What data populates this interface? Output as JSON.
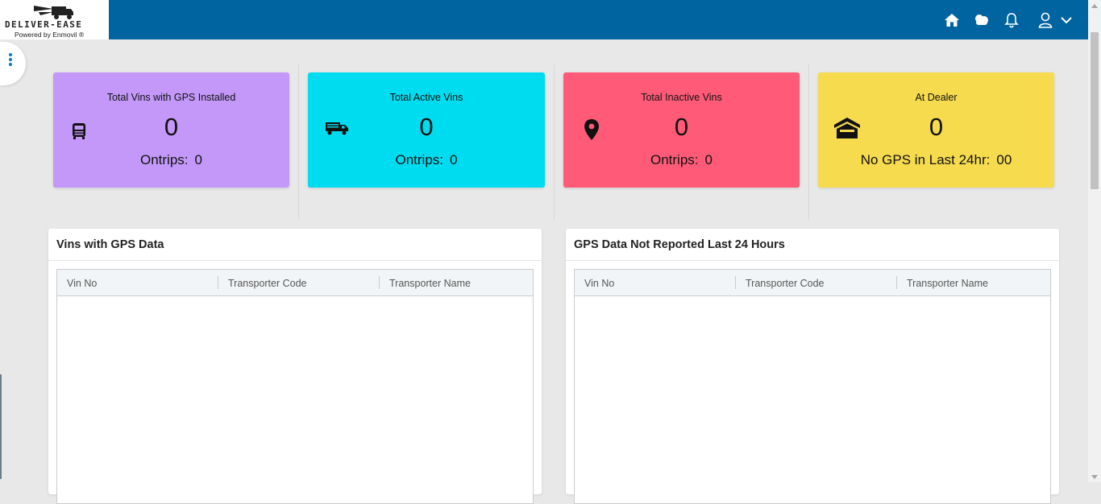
{
  "brand": {
    "name": "DELIVER-EASE",
    "tagline": "Powered by Enmovil ®"
  },
  "topbar": {
    "icons": [
      "home-icon",
      "cloud-icon",
      "bell-icon",
      "user-icon",
      "chevron-down-icon"
    ],
    "color": "#0064a0"
  },
  "cards": [
    {
      "title": "Total Vins with GPS Installed",
      "count": "0",
      "sub_label": "Ontrips:",
      "sub_value": "0",
      "icon": "truck-front-icon",
      "color": "#c398f9"
    },
    {
      "title": "Total Active Vins",
      "count": "0",
      "sub_label": "Ontrips:",
      "sub_value": "0",
      "icon": "truck-side-icon",
      "color": "#00dcef"
    },
    {
      "title": "Total Inactive Vins",
      "count": "0",
      "sub_label": "Ontrips:",
      "sub_value": "0",
      "icon": "map-marker-icon",
      "color": "#ff5a78"
    },
    {
      "title": "At Dealer",
      "count": "0",
      "sub_label": "No GPS in Last 24hr:",
      "sub_value": "00",
      "icon": "warehouse-icon",
      "color": "#f6db4f"
    }
  ],
  "panels": [
    {
      "title": "Vins with GPS Data",
      "columns": [
        "Vin No",
        "Transporter Code",
        "Transporter Name"
      ]
    },
    {
      "title": "GPS Data Not Reported Last 24 Hours",
      "columns": [
        "Vin No",
        "Transporter Code",
        "Transporter Name"
      ]
    }
  ]
}
